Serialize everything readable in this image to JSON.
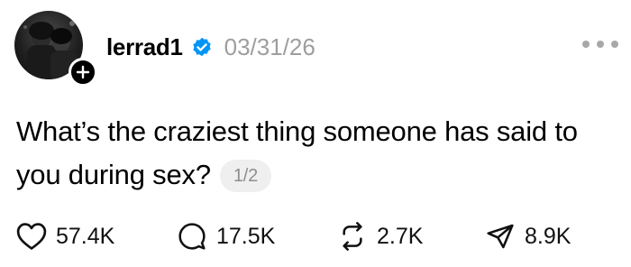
{
  "post": {
    "username": "lerrad1",
    "verified": true,
    "date": "03/31/26",
    "text": "What’s the craziest thing someone has said to you during sex?",
    "thread_counter": "1/2"
  },
  "icons": {
    "avatar": "profile-photo",
    "follow": "plus-icon",
    "verified": "verified-badge-icon",
    "more": "ellipsis-icon",
    "like": "heart-icon",
    "reply": "comment-icon",
    "repost": "repost-icon",
    "share": "send-icon"
  },
  "actions": {
    "likes": "57.4K",
    "replies": "17.5K",
    "reposts": "2.7K",
    "shares": "8.9K"
  },
  "colors": {
    "verified_blue": "#0095f6",
    "date_gray": "#9e9e9e",
    "counter_bg": "#efefef"
  }
}
